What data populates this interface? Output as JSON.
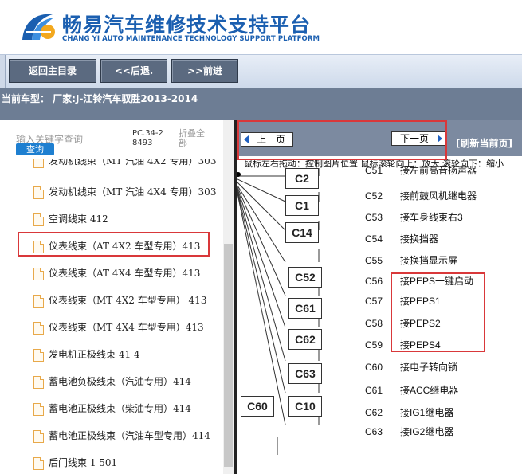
{
  "header": {
    "title": "畅易汽车维修技术支持平台",
    "subtitle": "CHANG YI AUTO MAINTENANCE TECHNOLOGY SUPPORT PLATFORM"
  },
  "nav": {
    "home": "返回主目录",
    "back": "<<后退.",
    "forward": ">>前进"
  },
  "vehicle": {
    "text": "当前车型： 厂家:J-江铃汽车驭胜2013-2014"
  },
  "search": {
    "hint": "输入关键字查询",
    "button": "查询",
    "code": "PC.34-28493",
    "collapse": "折叠全部"
  },
  "tree": {
    "items": [
      {
        "label": "发动机线束（MT 汽油 4X2 专用）303"
      },
      {
        "label": "发动机线束（MT 汽油 4X4 专用）303"
      },
      {
        "label": "空调线束 412"
      },
      {
        "label": "仪表线束（AT 4X2 车型专用）413"
      },
      {
        "label": "仪表线束（AT 4X4 车型专用）413"
      },
      {
        "label": "仪表线束（MT 4X2 车型专用） 413"
      },
      {
        "label": "仪表线束（MT 4X4 车型专用）413"
      },
      {
        "label": "发电机正极线束 41 4"
      },
      {
        "label": "蓄电池负极线束（汽油专用）414"
      },
      {
        "label": "蓄电池正极线束（柴油专用）414"
      },
      {
        "label": "蓄电池正极线束（汽油车型专用）414"
      },
      {
        "label": "后门线束 1 501"
      }
    ]
  },
  "viewer": {
    "prev": "上一页",
    "next": "下一页",
    "refresh": "[刷新当前页]",
    "hint": "鼠标左右拖动：控制图片位置  鼠标滚轮向上：放大  滚轮向下：缩小"
  },
  "diagram": {
    "connectors": [
      "C2",
      "C1",
      "C14",
      "C52",
      "C61",
      "C62",
      "C63",
      "C10",
      "C60"
    ],
    "labels": [
      {
        "code": "C51",
        "text": "接左前高音扬声器"
      },
      {
        "code": "C52",
        "text": "接前鼓风机继电器"
      },
      {
        "code": "C53",
        "text": "接车身线束右3"
      },
      {
        "code": "C54",
        "text": "接换挡器"
      },
      {
        "code": "C55",
        "text": "接换挡显示屏"
      },
      {
        "code": "C56",
        "text": "接PEPS一键启动"
      },
      {
        "code": "C57",
        "text": "接PEPS1"
      },
      {
        "code": "C58",
        "text": "接PEPS2"
      },
      {
        "code": "C59",
        "text": "接PEPS4"
      },
      {
        "code": "C60",
        "text": "接电子转向锁"
      },
      {
        "code": "C61",
        "text": "接ACC继电器"
      },
      {
        "code": "C62",
        "text": "接IG1继电器"
      },
      {
        "code": "C63",
        "text": "接IG2继电器"
      }
    ]
  },
  "colors": {
    "brand": "#1b5fb0",
    "nav_button": "#5b6a80",
    "vehicle_bar": "#6d7d94",
    "highlight": "#d9383a",
    "query_button": "#1e7fd0"
  }
}
